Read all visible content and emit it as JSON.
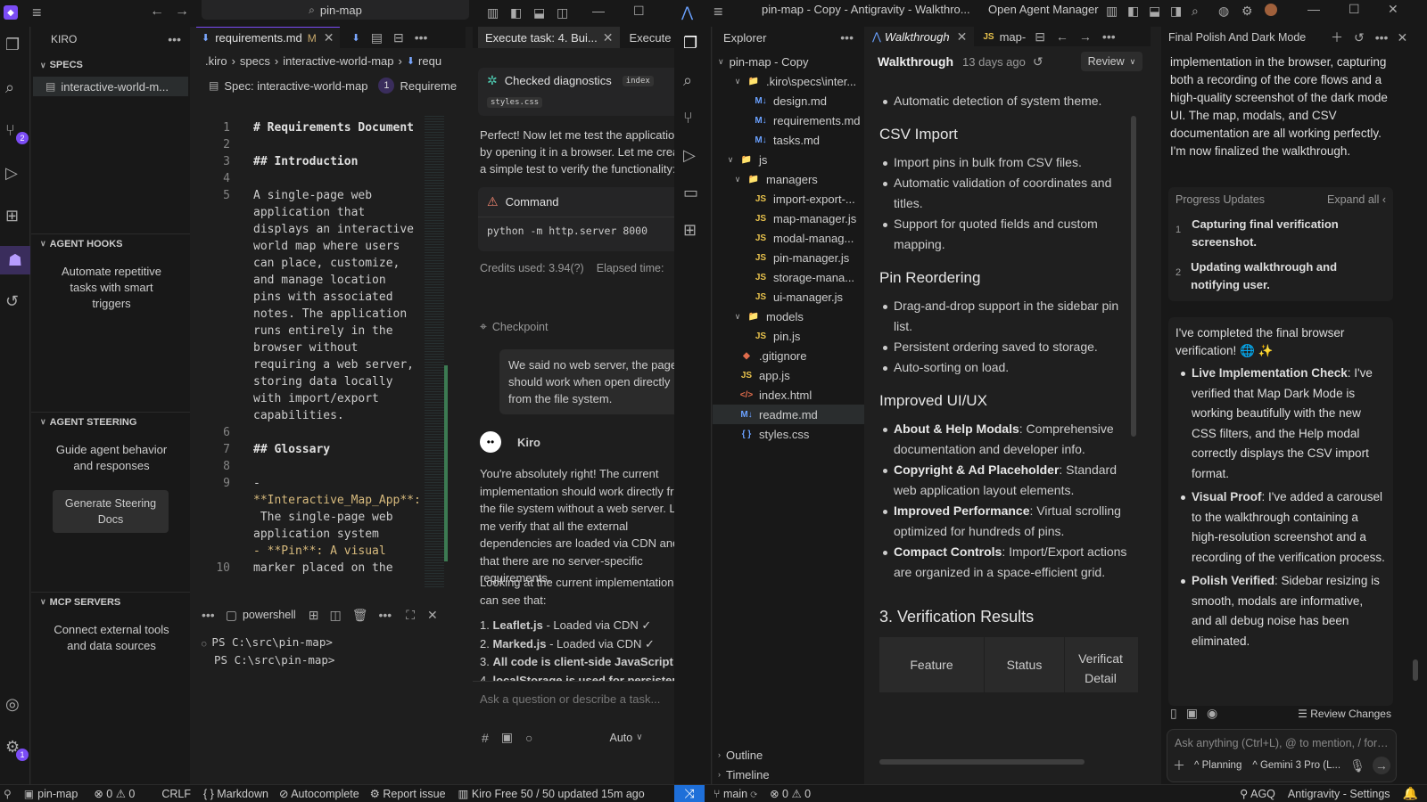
{
  "left_app": {
    "title": "pin-map",
    "sidebar_title": "KIRO",
    "specs": {
      "header": "SPECS",
      "item": "interactive-world-m..."
    },
    "agent_hooks": {
      "header": "AGENT HOOKS",
      "hint": "Automate repetitive tasks with smart triggers"
    },
    "agent_steering": {
      "header": "AGENT STEERING",
      "hint": "Guide agent behavior and responses",
      "button": "Generate Steering Docs"
    },
    "mcp": {
      "header": "MCP SERVERS",
      "hint": "Connect external tools and data sources"
    },
    "scm_badge": "2",
    "settings_badge": "1",
    "editor": {
      "tab": "requirements.md",
      "tab_mod": "M",
      "breadcrumb": [
        ".kiro",
        "specs",
        "interactive-world-map",
        "requ"
      ],
      "spec_label": "Spec: interactive-world-map",
      "spec_step": "1",
      "spec_step_label": "Requireme",
      "lines": [
        {
          "n": "1",
          "t": "# Requirements Document",
          "k": "h"
        },
        {
          "n": "2",
          "t": "",
          "k": "p"
        },
        {
          "n": "3",
          "t": "## Introduction",
          "k": "h"
        },
        {
          "n": "4",
          "t": "",
          "k": "p"
        },
        {
          "n": "5",
          "t": "A single-page web",
          "k": "p"
        },
        {
          "n": "",
          "t": "application that",
          "k": "p"
        },
        {
          "n": "",
          "t": "displays an interactive",
          "k": "p"
        },
        {
          "n": "",
          "t": "world map where users",
          "k": "p"
        },
        {
          "n": "",
          "t": "can place, customize,",
          "k": "p"
        },
        {
          "n": "",
          "t": "and manage location",
          "k": "p"
        },
        {
          "n": "",
          "t": "pins with associated",
          "k": "p"
        },
        {
          "n": "",
          "t": "notes. The application",
          "k": "p"
        },
        {
          "n": "",
          "t": "runs entirely in the",
          "k": "p"
        },
        {
          "n": "",
          "t": "browser without",
          "k": "p"
        },
        {
          "n": "",
          "t": "requiring a web server,",
          "k": "p"
        },
        {
          "n": "",
          "t": "storing data locally",
          "k": "p"
        },
        {
          "n": "",
          "t": "with import/export",
          "k": "p"
        },
        {
          "n": "",
          "t": "capabilities.",
          "k": "p"
        },
        {
          "n": "6",
          "t": "",
          "k": "p"
        },
        {
          "n": "7",
          "t": "## Glossary",
          "k": "h"
        },
        {
          "n": "8",
          "t": "",
          "k": "p"
        },
        {
          "n": "9",
          "t": "-",
          "k": "p"
        },
        {
          "n": "",
          "t": "**Interactive_Map_App**:",
          "k": "b"
        },
        {
          "n": "",
          "t": " The single-page web",
          "k": "p"
        },
        {
          "n": "",
          "t": "application system",
          "k": "p"
        },
        {
          "n": "",
          "t": "- **Pin**: A visual",
          "k": "b"
        },
        {
          "n": "10",
          "t": "marker placed on the",
          "k": "p"
        }
      ]
    },
    "terminal": {
      "shell": "powershell",
      "lines": [
        "PS C:\\src\\pin-map>",
        "PS C:\\src\\pin-map>"
      ]
    },
    "chat": {
      "tab1": "Execute task: 4. Bui...",
      "tab2": "Execute",
      "diag_title": "Checked diagnostics",
      "diag_chip": "index",
      "diag_file": "styles.css",
      "p1": "Perfect! Now let me test the application by opening it in a browser. Let me create a simple test to verify the functionality:",
      "cmd_title": "Command",
      "cmd": "python -m http.server 8000",
      "credits": "Credits used: 3.94(?)",
      "elapsed": "Elapsed time:",
      "checkpoint": "Checkpoint",
      "user_msg": "We said no web server, the page should work when open directly from the file system.",
      "agent_name": "Kiro",
      "p2": "You're absolutely right! The current implementation should work directly from the file system without a web server. Let me verify that all the external dependencies are loaded via CDN and that there are no server-specific requirements.",
      "p3": "Looking at the current implementation, I can see that:",
      "list": [
        {
          "b": "Leaflet.js",
          "t": " - Loaded via CDN ✓"
        },
        {
          "b": "Marked.js",
          "t": " - Loaded via CDN ✓"
        },
        {
          "b": "All code is client-side JavaScript",
          "t": ""
        },
        {
          "b": "localStorage is used for persistence",
          "t": ""
        }
      ],
      "input_ph": "Ask a question or describe a task...",
      "mode": "Auto"
    },
    "status": {
      "repo": "pin-map",
      "errors": "0",
      "warnings": "0",
      "eol": "CRLF",
      "lang": "Markdown",
      "autocomplete": "Autocomplete",
      "report": "Report issue",
      "plan": "Kiro Free 50 / 50 updated 15m ago"
    }
  },
  "right_app": {
    "title": "pin-map - Copy - Antigravity - Walkthro...",
    "open_agent": "Open Agent Manager",
    "explorer": {
      "title": "Explorer",
      "root": "pin-map - Copy",
      "items": [
        {
          "l": "3",
          "t": ".kiro\\specs\\inter...",
          "ic": "folder",
          "open": true
        },
        {
          "l": "4",
          "t": "design.md",
          "ic": "md"
        },
        {
          "l": "4",
          "t": "requirements.md",
          "ic": "md"
        },
        {
          "l": "4",
          "t": "tasks.md",
          "ic": "md"
        },
        {
          "l": "2",
          "t": "js",
          "ic": "folder",
          "open": true
        },
        {
          "l": "3",
          "t": "managers",
          "ic": "folder",
          "open": true
        },
        {
          "l": "4",
          "t": "import-export-...",
          "ic": "js"
        },
        {
          "l": "4",
          "t": "map-manager.js",
          "ic": "js"
        },
        {
          "l": "4",
          "t": "modal-manag...",
          "ic": "js"
        },
        {
          "l": "4",
          "t": "pin-manager.js",
          "ic": "js"
        },
        {
          "l": "4",
          "t": "storage-mana...",
          "ic": "js"
        },
        {
          "l": "4",
          "t": "ui-manager.js",
          "ic": "js"
        },
        {
          "l": "3",
          "t": "models",
          "ic": "folder",
          "open": true
        },
        {
          "l": "4",
          "t": "pin.js",
          "ic": "js"
        },
        {
          "l": "2",
          "t": ".gitignore",
          "ic": "git"
        },
        {
          "l": "2",
          "t": "app.js",
          "ic": "js"
        },
        {
          "l": "2",
          "t": "index.html",
          "ic": "html"
        },
        {
          "l": "2",
          "t": "readme.md",
          "ic": "md",
          "sel": true
        },
        {
          "l": "2",
          "t": "styles.css",
          "ic": "css"
        }
      ],
      "outline": "Outline",
      "timeline": "Timeline"
    },
    "walk": {
      "tab1": "Walkthrough",
      "tab2": "map-",
      "title": "Walkthrough",
      "age": "13 days ago",
      "review": "Review",
      "top_item": "Automatic detection of system theme.",
      "sections": [
        {
          "h": "CSV Import",
          "items": [
            {
              "b": "",
              "t": "Import pins in bulk from CSV files."
            },
            {
              "b": "",
              "t": "Automatic validation of coordinates and titles."
            },
            {
              "b": "",
              "t": "Support for quoted fields and custom mapping."
            }
          ]
        },
        {
          "h": "Pin Reordering",
          "items": [
            {
              "b": "",
              "t": "Drag-and-drop support in the sidebar pin list."
            },
            {
              "b": "",
              "t": "Persistent ordering saved to storage."
            },
            {
              "b": "",
              "t": "Auto-sorting on load."
            }
          ]
        },
        {
          "h": "Improved UI/UX",
          "items": [
            {
              "b": "About & Help Modals",
              "t": ": Comprehensive documentation and developer info."
            },
            {
              "b": "Copyright & Ad Placeholder",
              "t": ": Standard web application layout elements."
            },
            {
              "b": "Improved Performance",
              "t": ": Virtual scrolling optimized for hundreds of pins."
            },
            {
              "b": "Compact Controls",
              "t": ": Import/Export actions are organized in a space-efficient grid."
            }
          ]
        }
      ],
      "verify_h": "3. Verification Results",
      "table_cols": [
        "Feature",
        "Status",
        "Verificat Detail"
      ]
    },
    "agent": {
      "title": "Final Polish And Dark Mode",
      "intro": "implementation in the browser, capturing both a recording of the core flows and a high-quality screenshot of the dark mode UI. The map, modals, and CSV documentation are all working perfectly. I'm now finalized the walkthrough.",
      "progress_label": "Progress Updates",
      "expand_all": "Expand all",
      "progress": [
        {
          "n": "1",
          "t": "Capturing final verification screenshot."
        },
        {
          "n": "2",
          "t": "Updating walkthrough and notifying user."
        }
      ],
      "done": "I've completed the final browser verification! 🌐 ✨",
      "bullets": [
        {
          "b": "Live Implementation Check",
          "t": ": I've verified that Map Dark Mode is working beautifully with the new CSS filters, and the Help modal correctly displays the CSV import format."
        },
        {
          "b": "Visual Proof",
          "t": ": I've added a carousel to the walkthrough containing a high-resolution screenshot and a recording of the verification process."
        },
        {
          "b": "Polish Verified",
          "t": ": Sidebar resizing is smooth, modals are informative, and all debug noise has been eliminated."
        }
      ],
      "review_changes": "Review Changes",
      "input_ph": "Ask anything (Ctrl+L), @ to mention, / for workfl",
      "planning": "Planning",
      "model": "Gemini 3 Pro (L..."
    },
    "status": {
      "branch": "main",
      "errors": "0",
      "warnings": "0",
      "agq": "AGQ",
      "settings": "Antigravity - Settings"
    }
  }
}
